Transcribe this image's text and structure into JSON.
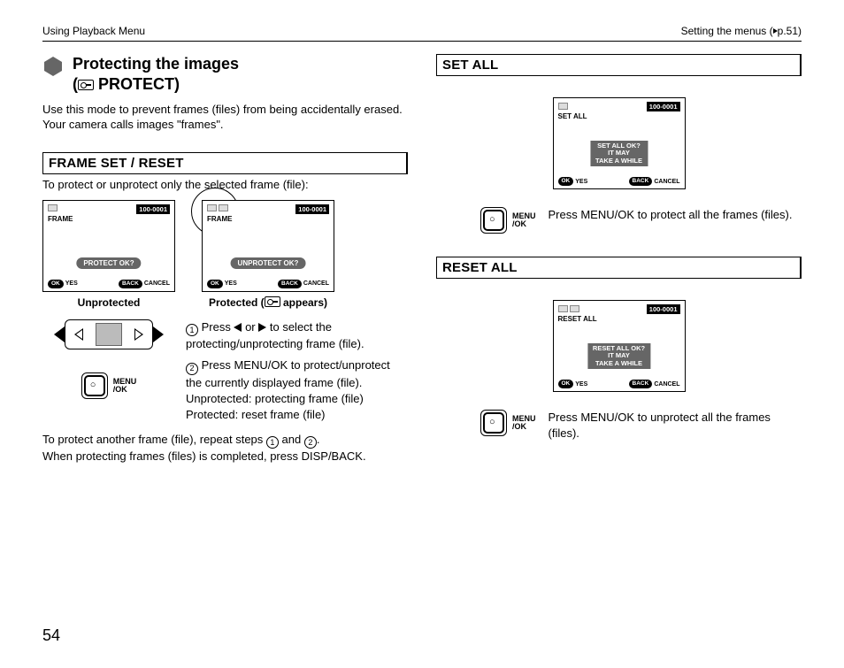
{
  "header": {
    "left": "Using Playback Menu",
    "right_prefix": "Setting the menus (",
    "right_suffix": "p.51)"
  },
  "title": {
    "line1": "Protecting the images",
    "line2_prefix": "(",
    "line2_word": " PROTECT)"
  },
  "intro": "Use this mode to prevent frames (files) from being accidentally erased. Your camera calls images \"frames\".",
  "frame_set": {
    "heading": "FRAME SET / RESET",
    "sub": "To protect or unprotect only the selected frame (file):",
    "lcd1": {
      "file_no": "100-0001",
      "label": "FRAME",
      "prompt": "PROTECT OK?",
      "ok": "OK",
      "yes": "YES",
      "back": "BACK",
      "cancel": "CANCEL"
    },
    "lcd2": {
      "file_no": "100-0001",
      "label": "FRAME",
      "prompt": "UNPROTECT OK?",
      "ok": "OK",
      "yes": "YES",
      "back": "BACK",
      "cancel": "CANCEL"
    },
    "cap1": "Unprotected",
    "cap2_prefix": "Protected (",
    "cap2_suffix": " appears)",
    "step1_a": "Press ",
    "step1_b": " or ",
    "step1_c": " to select the protecting/unprotecting frame (file).",
    "step2_a": "Press MENU/OK to protect/unprotect the currently displayed frame (file).",
    "step2_b": "Unprotected: protecting frame (file)",
    "step2_c": "Protected: reset frame (file)",
    "foot_a": "To protect another frame (file), repeat steps ",
    "foot_b": " and ",
    "foot_c": ".",
    "foot_d": "When protecting frames (files) is completed, press DISP/BACK."
  },
  "set_all": {
    "heading": "SET ALL",
    "lcd": {
      "file_no": "100-0001",
      "label": "SET ALL",
      "prompt1": "SET ALL OK?",
      "prompt2": "IT MAY",
      "prompt3": "TAKE A WHILE",
      "ok": "OK",
      "yes": "YES",
      "back": "BACK",
      "cancel": "CANCEL"
    },
    "step": "Press MENU/OK to protect all the frames (files)."
  },
  "reset_all": {
    "heading": "RESET ALL",
    "lcd": {
      "file_no": "100-0001",
      "label": "RESET ALL",
      "prompt1": "RESET ALL OK?",
      "prompt2": "IT MAY",
      "prompt3": "TAKE A WHILE",
      "ok": "OK",
      "yes": "YES",
      "back": "BACK",
      "cancel": "CANCEL"
    },
    "step": "Press MENU/OK to unprotect all the frames (files)."
  },
  "menuok_label": {
    "l1": "MENU",
    "l2": "/OK"
  },
  "page_number": "54"
}
